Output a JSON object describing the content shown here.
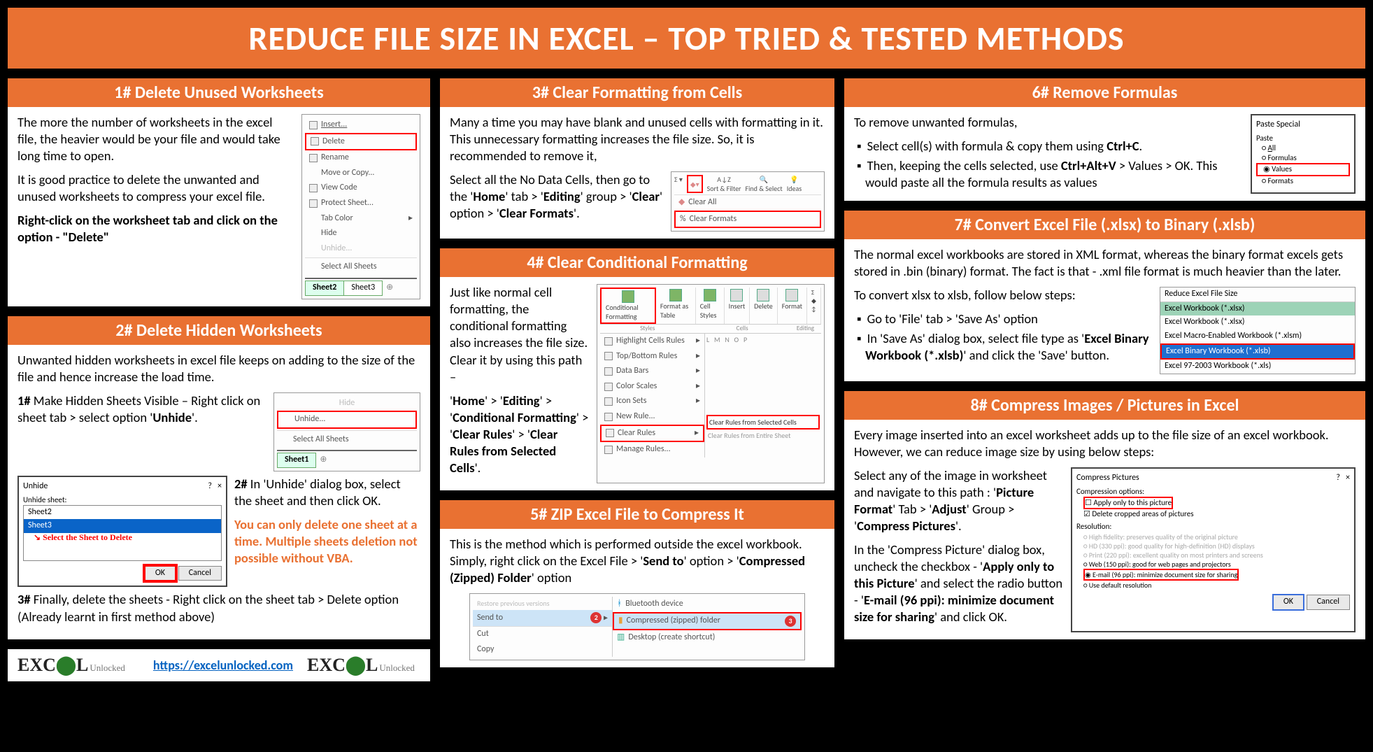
{
  "title": "REDUCE FILE SIZE IN EXCEL – TOP TRIED & TESTED METHODS",
  "footer_link": "https://excelunlocked.com",
  "logo_text_big": "EXCEL",
  "logo_text_sub": "Unlocked",
  "c1": {
    "title": "1# Delete Unused Worksheets",
    "p1": "The more the number of worksheets in the excel file, the heavier would be your file and would take long time to open.",
    "p2": "It is good practice to delete the unwanted and unused worksheets to compress your excel file.",
    "p3a": "Right-click on the worksheet tab and click on the option - ",
    "p3b": "\"Delete\"",
    "menu": {
      "insert": "Insert...",
      "delete": "Delete",
      "rename": "Rename",
      "move": "Move or Copy...",
      "view": "View Code",
      "protect": "Protect Sheet...",
      "tab": "Tab Color",
      "hide": "Hide",
      "unhide": "Unhide...",
      "selall": "Select All Sheets"
    },
    "tab_active": "Sheet2",
    "tab_other": "Sheet3"
  },
  "c2": {
    "title": "2# Delete Hidden Worksheets",
    "p1": "Unwanted hidden worksheets in excel file keeps on adding to the size of the file and hence increase the load time.",
    "s1a": "1# ",
    "s1b": "Make Hidden Sheets Visible – Right click on sheet tab > select option '",
    "s1c": "Unhide",
    "s1d": "'.",
    "menu_hide": "Hide",
    "menu_unhide": "Unhide...",
    "menu_selall": "Select All Sheets",
    "tab_active": "Sheet1",
    "dlg_title": "Unhide",
    "dlg_label": "Unhide sheet:",
    "dlg_row1": "Sheet2",
    "dlg_row2": "Sheet3",
    "dlg_arrow_note": "Select the Sheet to Delete",
    "btn_ok": "OK",
    "btn_cancel": "Cancel",
    "s2a": "2# ",
    "s2b": "In 'Unhide' dialog box, select the sheet and then click OK.",
    "note": "You can only delete one sheet at a time. Multiple sheets deletion not possible without VBA.",
    "s3a": "3# ",
    "s3b": "Finally, delete the sheets - Right click on the sheet tab > Delete option (Already learnt in first method above)"
  },
  "c3": {
    "title": "3# Clear Formatting from Cells",
    "p1": "Many a time you may have blank and unused cells with formatting in it. This unnecessary formatting increases the file size. So, it is recommended to remove it,",
    "p2a": "Select all the No Data Cells, then go to the '",
    "p2b": "Home",
    "p2c": "' tab > '",
    "p2d": "Editing",
    "p2e": "' group > '",
    "p2f": "Clear",
    "p2g": "' option > '",
    "p2h": "Clear Formats",
    "p2i": "'.",
    "shot_sort": "Sort & Filter",
    "shot_find": "Find & Select",
    "shot_ideas": "Ideas",
    "shot_clearall": "Clear All",
    "shot_clearformats": "Clear Formats"
  },
  "c4": {
    "title": "4# Clear Conditional Formatting",
    "p1": "Just like normal cell formatting, the conditional formatting also increases the file size. Clear it by using this path –",
    "p2a": "'",
    "p2b": "Home",
    "p2c": "' > '",
    "p2d": "Editing",
    "p2e": "' > '",
    "p2f": "Conditional Formatting",
    "p2g": "' > '",
    "p2h": "Clear Rules",
    "p2i": "' > '",
    "p2j": "Clear Rules from Selected Cells",
    "p2k": "'.",
    "rib_cond": "Conditional Formatting",
    "rib_fmt": "Format as Table",
    "rib_cell": "Cell Styles",
    "rib_ins": "Insert",
    "rib_del": "Delete",
    "rib_fmt2": "Format",
    "rib_group1": "Styles",
    "rib_group2": "Cells",
    "rib_group3": "Editing",
    "m_high": "Highlight Cells Rules",
    "m_top": "Top/Bottom Rules",
    "m_bars": "Data Bars",
    "m_scales": "Color Scales",
    "m_icons": "Icon Sets",
    "m_new": "New Rule...",
    "m_clear": "Clear Rules",
    "m_manage": "Manage Rules...",
    "m_clearsel": "Clear Rules from Selected Cells",
    "m_clearent": "Clear Rules from Entire Sheet"
  },
  "c5": {
    "title": "5# ZIP Excel File to Compress It",
    "p1a": "This is the method which is performed outside the excel workbook. Simply, right click on the Excel File > '",
    "p1b": "Send to",
    "p1c": "' option > '",
    "p1d": "Compressed (Zipped) Folder",
    "p1e": "' option",
    "m_restore": "Restore previous versions",
    "m_send": "Send to",
    "m_cut": "Cut",
    "m_copy": "Copy",
    "s_bt": "Bluetooth device",
    "s_zip": "Compressed (zipped) folder",
    "s_desk": "Desktop (create shortcut)",
    "num2": "2",
    "num3": "3"
  },
  "c6": {
    "title": "6# Remove Formulas",
    "p1": "To remove unwanted formulas,",
    "b1a": "Select cell(s) with formula & copy them using ",
    "b1b": "Ctrl+C",
    "b1c": ".",
    "b2a": "Then, keeping the cells selected, use ",
    "b2b": "Ctrl+Alt+V",
    "b2c": " > Values > OK. This would paste all the formula results as values",
    "dlg_title": "Paste Special",
    "dlg_sect": "Paste",
    "opt_all": "All",
    "opt_form": "Formulas",
    "opt_val": "Values",
    "opt_fmt": "Formats"
  },
  "c7": {
    "title": "7# Convert Excel File (.xlsx) to Binary (.xlsb)",
    "p1": "The normal excel workbooks are stored in XML format, whereas the binary format excels gets stored in .bin (binary) format. The fact is that - .xml file format is much heavier than the later.",
    "p2": "To convert xlsx to xlsb, follow below steps:",
    "b1": "Go to 'File' tab > 'Save As' option",
    "b2a": "In 'Save As' dialog box, select file type as '",
    "b2b": "Excel Binary Workbook (*.xlsb)",
    "b2c": "' and click the 'Save' button.",
    "list_title": "Reduce Excel File Size",
    "l1": "Excel Workbook (*.xlsx)",
    "l2": "Excel Workbook (*.xlsx)",
    "l3": "Excel Macro-Enabled Workbook (*.xlsm)",
    "l4": "Excel Binary Workbook (*.xlsb)",
    "l5": "Excel 97-2003 Workbook (*.xls)"
  },
  "c8": {
    "title": "8# Compress Images / Pictures in Excel",
    "p1": "Every image inserted into an excel worksheet adds up to the file size of an excel workbook. However, we can reduce image size by using below steps:",
    "p2a": "Select any of the image in worksheet and navigate to this path : '",
    "p2b": "Picture Format",
    "p2c": "' Tab > '",
    "p2d": "Adjust",
    "p2e": "' Group > '",
    "p2f": "Compress Pictures",
    "p2g": "'.",
    "p3a": "In the 'Compress Picture' dialog box, uncheck the checkbox - '",
    "p3b": "Apply only to this Picture",
    "p3c": "' and select the radio button - '",
    "p3d": "E-mail (96 ppi): minimize document size for sharing",
    "p3e": "' and click OK.",
    "dlg_title": "Compress Pictures",
    "sect1": "Compression options:",
    "chk1": "Apply only to this picture",
    "chk2": "Delete cropped areas of pictures",
    "sect2": "Resolution:",
    "r1": "High fidelity: preserves quality of the original picture",
    "r2": "HD (330 ppi): good quality for high-definition (HD) displays",
    "r3": "Print (220 ppi): excellent quality on most printers and screens",
    "r4": "Web (150 ppi): good for web pages and projectors",
    "r5": "E-mail (96 ppi): minimize document size for sharing",
    "r6": "Use default resolution",
    "btn_ok": "OK",
    "btn_cancel": "Cancel"
  }
}
